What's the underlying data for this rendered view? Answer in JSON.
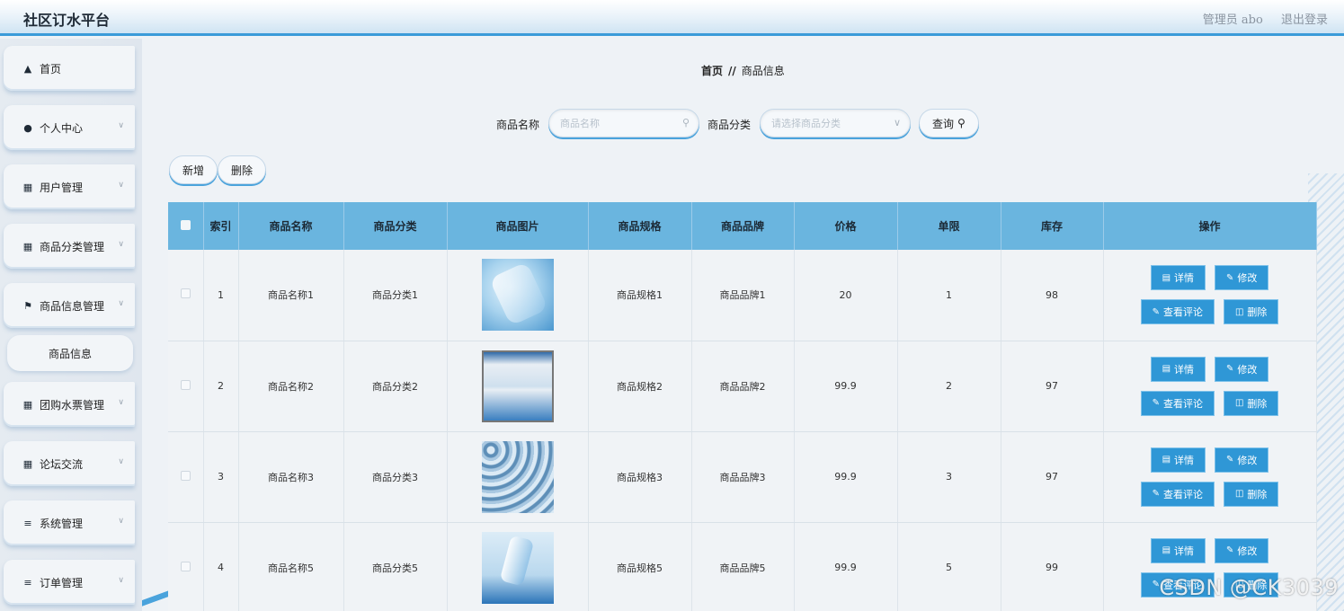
{
  "app": {
    "title": "社区订水平台",
    "user_label": "管理员 abo",
    "logout_label": "退出登录"
  },
  "sidebar": {
    "items": [
      {
        "label": "首页",
        "icon": "home-icon",
        "has_children": false
      },
      {
        "label": "个人中心",
        "icon": "user-icon",
        "has_children": true
      },
      {
        "label": "用户管理",
        "icon": "grid-icon",
        "has_children": true
      },
      {
        "label": "商品分类管理",
        "icon": "grid-icon",
        "has_children": true
      },
      {
        "label": "商品信息管理",
        "icon": "flag-icon",
        "has_children": true
      },
      {
        "label": "团购水票管理",
        "icon": "document-icon",
        "has_children": true
      },
      {
        "label": "论坛交流",
        "icon": "grid-icon",
        "has_children": true
      },
      {
        "label": "系统管理",
        "icon": "sliders-icon",
        "has_children": true
      },
      {
        "label": "订单管理",
        "icon": "list-icon",
        "has_children": true
      }
    ],
    "subitem": {
      "label": "商品信息"
    }
  },
  "breadcrumb": {
    "home": "首页",
    "separator": "//",
    "current": "商品信息"
  },
  "search": {
    "name_label": "商品名称",
    "name_placeholder": "商品名称",
    "category_label": "商品分类",
    "category_placeholder": "请选择商品分类",
    "query_label": "查询"
  },
  "actions": {
    "add_label": "新增",
    "delete_label": "删除"
  },
  "table": {
    "headers": [
      "",
      "索引",
      "商品名称",
      "商品分类",
      "商品图片",
      "商品规格",
      "商品品牌",
      "价格",
      "单限",
      "库存",
      "操作"
    ],
    "rows": [
      {
        "index": "1",
        "name": "商品名称1",
        "category": "商品分类1",
        "spec": "商品规格1",
        "brand": "商品品牌1",
        "price": "20",
        "limit": "1",
        "stock": "98"
      },
      {
        "index": "2",
        "name": "商品名称2",
        "category": "商品分类2",
        "spec": "商品规格2",
        "brand": "商品品牌2",
        "price": "99.9",
        "limit": "2",
        "stock": "97"
      },
      {
        "index": "3",
        "name": "商品名称3",
        "category": "商品分类3",
        "spec": "商品规格3",
        "brand": "商品品牌3",
        "price": "99.9",
        "limit": "3",
        "stock": "97"
      },
      {
        "index": "4",
        "name": "商品名称5",
        "category": "商品分类5",
        "spec": "商品规格5",
        "brand": "商品品牌5",
        "price": "99.9",
        "limit": "5",
        "stock": "99"
      }
    ],
    "row_actions": {
      "detail": "详情",
      "edit": "修改",
      "comments": "查看评论",
      "delete": "删除"
    }
  },
  "watermark": "CSDN @CK3039",
  "colors": {
    "accent": "#2f97d6",
    "header_bg": "#6ab5df",
    "page_bg": "#eef2f6",
    "topbar_border": "#3a9bd9"
  }
}
